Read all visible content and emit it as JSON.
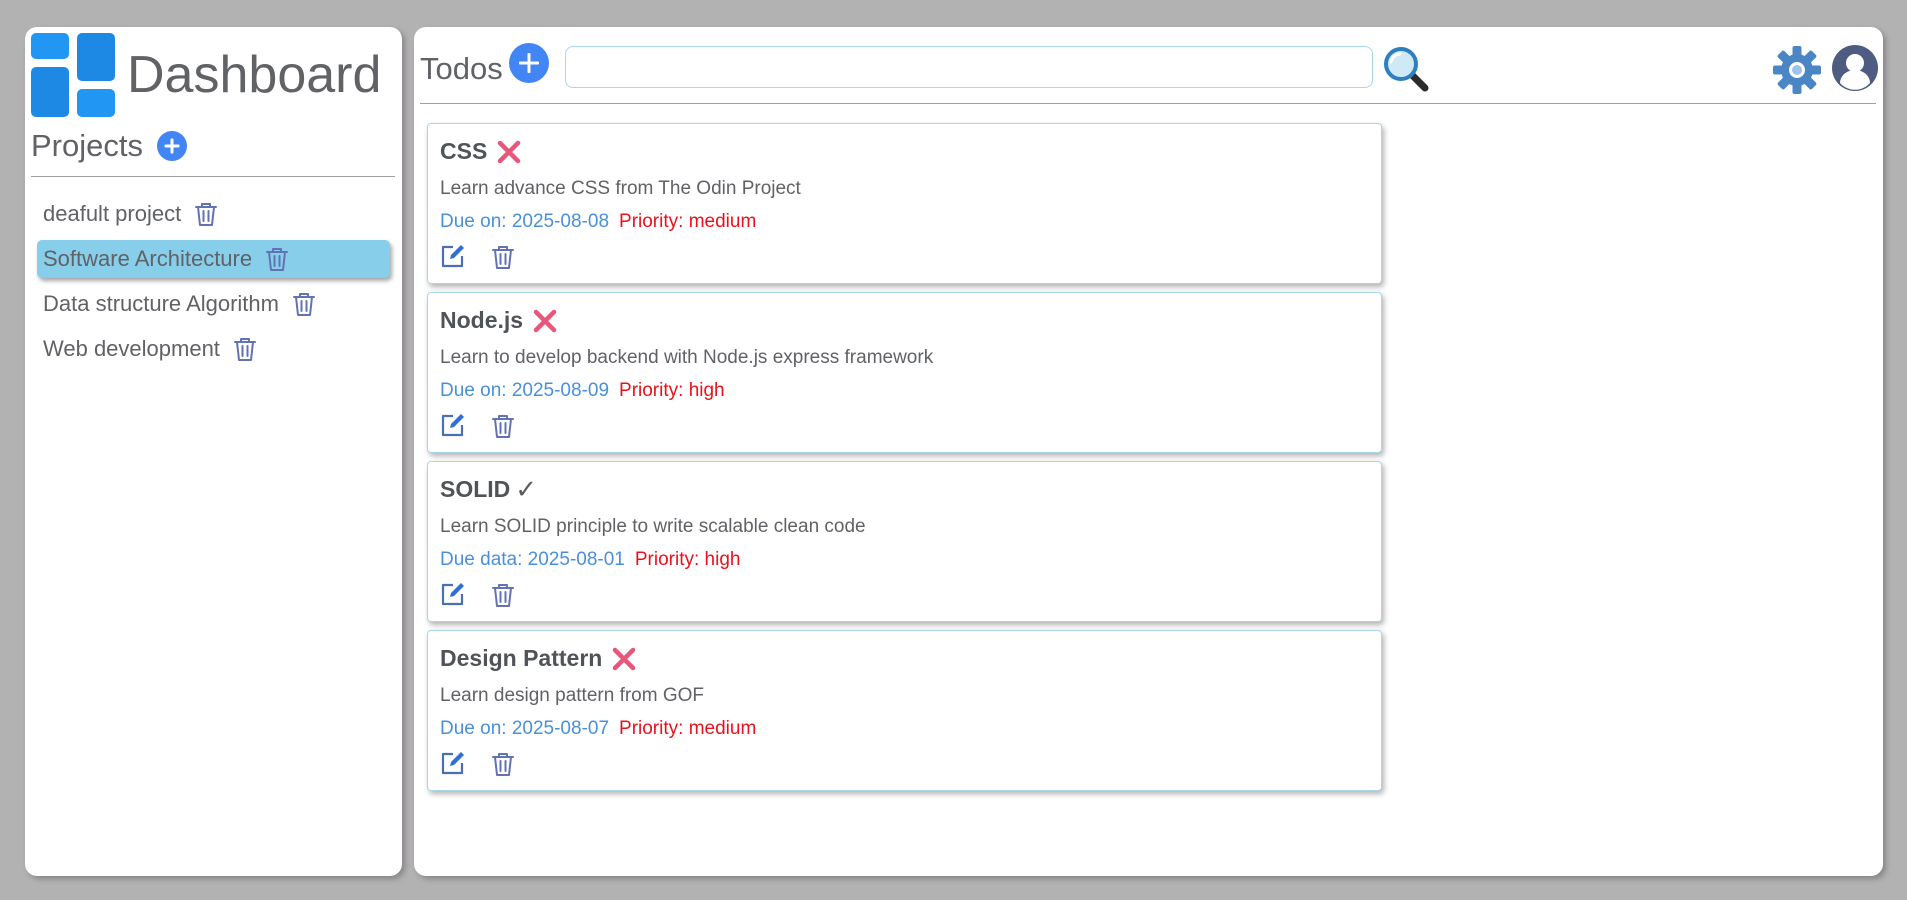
{
  "app": {
    "title": "Dashboard",
    "logo_colors": [
      "#1e88e5",
      "#2196f3",
      "#42a5f5"
    ]
  },
  "sidebar": {
    "heading": "Projects",
    "add_icon": "plus-icon",
    "items": [
      {
        "label": "deafult project",
        "active": false
      },
      {
        "label": "Software Architecture",
        "active": true
      },
      {
        "label": "Data structure Algorithm",
        "active": false
      },
      {
        "label": "Web development",
        "active": false
      }
    ]
  },
  "header": {
    "title": "Todos",
    "add_icon": "plus-icon",
    "search_value": "",
    "search_icon": "magnifier-icon",
    "settings_icon": "gear-icon",
    "profile_icon": "avatar-icon"
  },
  "todos": [
    {
      "title": "CSS",
      "status": "incomplete",
      "description": "Learn advance CSS from The Odin Project",
      "due": "Due on: 2025-08-08",
      "priority": "Priority: medium"
    },
    {
      "title": "Node.js",
      "status": "incomplete",
      "description": "Learn to develop backend with Node.js express framework",
      "due": "Due on: 2025-08-09",
      "priority": "Priority: high"
    },
    {
      "title": "SOLID",
      "status": "complete",
      "check_glyph": "✓",
      "description": "Learn SOLID principle to write scalable clean code",
      "due": "Due data: 2025-08-01",
      "priority": "Priority: high"
    },
    {
      "title": "Design Pattern",
      "status": "incomplete",
      "description": "Learn design pattern from GOF",
      "due": "Due on: 2025-08-07",
      "priority": "Priority: medium"
    }
  ],
  "colors": {
    "accent": "#4285f4",
    "active_project": "#87ceeb",
    "due_text": "#4a90d9",
    "priority_text": "#e8131a",
    "incomplete_mark": "#e8577a",
    "icon_stroke": "#6272b5"
  }
}
